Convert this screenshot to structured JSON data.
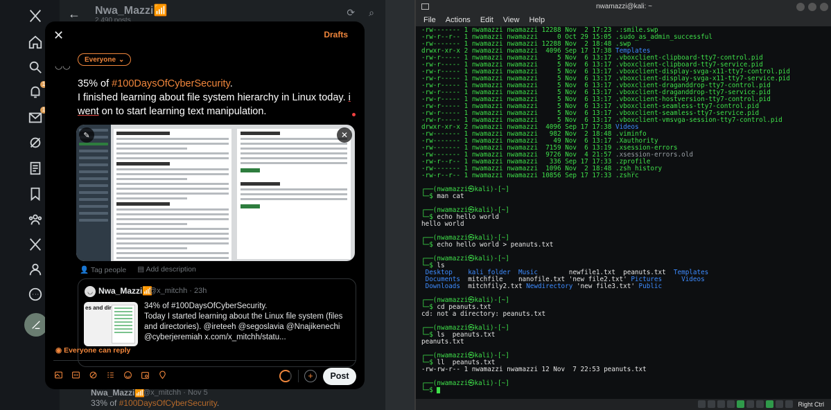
{
  "x": {
    "feed_header": {
      "back": "←",
      "name": "Nwa_Mazzi",
      "verified": "📶",
      "posts": "2,490 posts"
    },
    "nav_icons": [
      "x-logo-icon",
      "home-icon",
      "search-icon",
      "notifications-icon",
      "messages-icon",
      "grok-icon",
      "lists-icon",
      "bookmarks-icon",
      "communities-icon",
      "premium-icon",
      "profile-icon",
      "more-icon",
      "compose-icon"
    ],
    "notif_count": "1",
    "msg_count": "1",
    "modal": {
      "close": "✕",
      "drafts": "Drafts",
      "audience": "Everyone",
      "tweet_prefix": "35% of ",
      "tweet_hashtag": "#100DaysOfCyberSecurity",
      "tweet_after_hashtag": ".",
      "tweet_line2a": "I finished learning about file system hierarchy in Linux today. ",
      "tweet_err1": "i",
      "tweet_line3a": "went",
      "tweet_line3b": " on to start learning text manipulation.",
      "tag_people": "Tag people",
      "add_description": "Add description",
      "quote": {
        "name": "Nwa_Mazzi",
        "verified": "📶",
        "handle": "@x_mitchh · 23h",
        "thumb_title": "es and directo",
        "body": "34% of #100DaysOfCyberSecurity.\nToday I started learning about the Linux file system (files and directories). @ireteeh @segoslavia @Nnajikenechi @cyberjeremiah  x.com/x_mitchh/statu..."
      },
      "reply_setting": "Everyone can reply",
      "post_button": "Post",
      "add_thread": "+"
    },
    "bg_post": {
      "name": "Nwa_Mazzi📶",
      "handle": "@x_mitchh · Nov 5",
      "text_prefix": "33% of ",
      "hashtag": "#100DaysOfCyberSecurity",
      "text_suffix": "."
    }
  },
  "terminal": {
    "title": "nwamazzi@kali: ~",
    "menu": [
      "File",
      "Actions",
      "Edit",
      "View",
      "Help"
    ],
    "listing": [
      {
        "perm": "-rw-------",
        "links": "1",
        "user": "nwamazzi",
        "group": "nwamazzi",
        "size": "12288",
        "date": "Nov  2 17:23",
        "name": ".:smile.swp",
        "kind": "file"
      },
      {
        "perm": "-rw-r--r--",
        "links": "1",
        "user": "nwamazzi",
        "group": "nwamazzi",
        "size": "0",
        "date": "Oct 29 15:05",
        "name": ".sudo_as_admin_successful",
        "kind": "file"
      },
      {
        "perm": "-rw-------",
        "links": "1",
        "user": "nwamazzi",
        "group": "nwamazzi",
        "size": "12288",
        "date": "Nov  2 18:48",
        "name": ".swp",
        "kind": "file"
      },
      {
        "perm": "drwxr-xr-x",
        "links": "2",
        "user": "nwamazzi",
        "group": "nwamazzi",
        "size": "4096",
        "date": "Sep 17 17:38",
        "name": "Templates",
        "kind": "dir"
      },
      {
        "perm": "-rw-r-----",
        "links": "1",
        "user": "nwamazzi",
        "group": "nwamazzi",
        "size": "5",
        "date": "Nov  6 13:17",
        "name": ".vboxclient-clipboard-tty7-control.pid",
        "kind": "file"
      },
      {
        "perm": "-rw-r-----",
        "links": "1",
        "user": "nwamazzi",
        "group": "nwamazzi",
        "size": "5",
        "date": "Nov  6 13:17",
        "name": ".vboxclient-clipboard-tty7-service.pid",
        "kind": "file"
      },
      {
        "perm": "-rw-r-----",
        "links": "1",
        "user": "nwamazzi",
        "group": "nwamazzi",
        "size": "5",
        "date": "Nov  6 13:17",
        "name": ".vboxclient-display-svga-x11-tty7-control.pid",
        "kind": "file"
      },
      {
        "perm": "-rw-r-----",
        "links": "1",
        "user": "nwamazzi",
        "group": "nwamazzi",
        "size": "5",
        "date": "Nov  6 13:17",
        "name": ".vboxclient-display-svga-x11-tty7-service.pid",
        "kind": "file"
      },
      {
        "perm": "-rw-r-----",
        "links": "1",
        "user": "nwamazzi",
        "group": "nwamazzi",
        "size": "5",
        "date": "Nov  6 13:17",
        "name": ".vboxclient-draganddrop-tty7-control.pid",
        "kind": "file"
      },
      {
        "perm": "-rw-r-----",
        "links": "1",
        "user": "nwamazzi",
        "group": "nwamazzi",
        "size": "5",
        "date": "Nov  6 13:17",
        "name": ".vboxclient-draganddrop-tty7-service.pid",
        "kind": "file"
      },
      {
        "perm": "-rw-r-----",
        "links": "1",
        "user": "nwamazzi",
        "group": "nwamazzi",
        "size": "5",
        "date": "Nov  6 13:17",
        "name": ".vboxclient-hostversion-tty7-control.pid",
        "kind": "file"
      },
      {
        "perm": "-rw-r-----",
        "links": "1",
        "user": "nwamazzi",
        "group": "nwamazzi",
        "size": "5",
        "date": "Nov  6 13:17",
        "name": ".vboxclient-seamless-tty7-control.pid",
        "kind": "file"
      },
      {
        "perm": "-rw-r-----",
        "links": "1",
        "user": "nwamazzi",
        "group": "nwamazzi",
        "size": "5",
        "date": "Nov  6 13:17",
        "name": ".vboxclient-seamless-tty7-service.pid",
        "kind": "file"
      },
      {
        "perm": "-rw-r-----",
        "links": "1",
        "user": "nwamazzi",
        "group": "nwamazzi",
        "size": "5",
        "date": "Nov  6 13:17",
        "name": ".vboxclient-vmsvga-session-tty7-control.pid",
        "kind": "file"
      },
      {
        "perm": "drwxr-xr-x",
        "links": "2",
        "user": "nwamazzi",
        "group": "nwamazzi",
        "size": "4096",
        "date": "Sep 17 17:38",
        "name": "Videos",
        "kind": "dir"
      },
      {
        "perm": "-rw-------",
        "links": "1",
        "user": "nwamazzi",
        "group": "nwamazzi",
        "size": "982",
        "date": "Nov  2 18:48",
        "name": ".viminfo",
        "kind": "file"
      },
      {
        "perm": "-rw-------",
        "links": "1",
        "user": "nwamazzi",
        "group": "nwamazzi",
        "size": "49",
        "date": "Nov  6 13:17",
        "name": ".Xauthority",
        "kind": "file"
      },
      {
        "perm": "-rw-------",
        "links": "1",
        "user": "nwamazzi",
        "group": "nwamazzi",
        "size": "7159",
        "date": "Nov  6 13:19",
        "name": ".xsession-errors",
        "kind": "file"
      },
      {
        "perm": "-rw-------",
        "links": "1",
        "user": "nwamazzi",
        "group": "nwamazzi",
        "size": "9726",
        "date": "Nov  4 21:57",
        "name": ".xsession-errors.old",
        "kind": "old"
      },
      {
        "perm": "-rw-r--r--",
        "links": "1",
        "user": "nwamazzi",
        "group": "nwamazzi",
        "size": "336",
        "date": "Sep 17 17:33",
        "name": ".zprofile",
        "kind": "file"
      },
      {
        "perm": "-rw-------",
        "links": "1",
        "user": "nwamazzi",
        "group": "nwamazzi",
        "size": "1096",
        "date": "Nov  2 18:48",
        "name": ".zsh_history",
        "kind": "file"
      },
      {
        "perm": "-rw-r--r--",
        "links": "1",
        "user": "nwamazzi",
        "group": "nwamazzi",
        "size": "10856",
        "date": "Sep 17 17:33",
        "name": ".zshrc",
        "kind": "file"
      }
    ],
    "prompt_top": "┌──(nwamazzi㉿kali)-[~]",
    "prompt_bottom": "└─$",
    "sessions": [
      {
        "cmd": "man cat",
        "output": []
      },
      {
        "cmd": "echo hello world",
        "output": [
          "hello world"
        ]
      },
      {
        "cmd": "echo hello world > peanuts.txt",
        "output": []
      },
      {
        "cmd": "ls",
        "output": [],
        "ls_grid": [
          [
            "Desktop",
            "kali_folder",
            "Music",
            "newfile1.txt",
            "peanuts.txt",
            "Templates"
          ],
          [
            "Documents",
            "mitchfile",
            "nanofile.txt",
            "'new file2.txt'",
            "Pictures",
            "Videos"
          ],
          [
            "Downloads",
            "mitchfily2.txt",
            "Newdirectory",
            "'new file3.txt'",
            "Public",
            ""
          ]
        ]
      },
      {
        "cmd": "cd peanuts.txt",
        "output": [
          "cd: not a directory: peanuts.txt"
        ]
      },
      {
        "cmd": "ls  peanuts.txt",
        "output": [
          "peanuts.txt"
        ]
      },
      {
        "cmd": "ll  peanuts.txt",
        "output": [
          "-rw-rw-r-- 1 nwamazzi nwamazzi 12 Nov  7 22:53 peanuts.txt"
        ]
      }
    ],
    "taskbar_label": "Right Ctrl"
  },
  "colors": {
    "accent_orange": "#f0863c",
    "term_green": "#3fe04a",
    "term_blue": "#3d8bff"
  }
}
